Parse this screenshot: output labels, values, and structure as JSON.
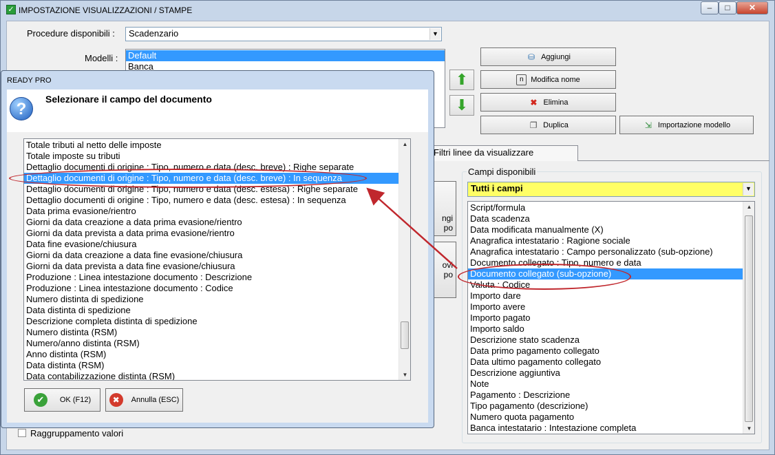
{
  "main": {
    "title": "IMPOSTAZIONE VISUALIZZAZIONI / STAMPE",
    "caption_buttons": {
      "minimize": "–",
      "maximize": "□",
      "close": "✕"
    },
    "procedure_label": "Procedure disponibili :",
    "procedure_value": "Scadenzario",
    "models_label": "Modelli :",
    "models": [
      "Default",
      "Banca"
    ],
    "buttons": {
      "add": "Aggiungi",
      "rename": "Modifica nome",
      "delete": "Elimina",
      "duplicate": "Duplica",
      "import": "Importazione modello"
    },
    "tab_filters": "Filtri linee da visualizzare",
    "partial_button_1": [
      "ngi",
      "po"
    ],
    "partial_button_2": [
      "ovi",
      "po"
    ],
    "available_fields_legend": "Campi disponibili",
    "fields_filter": "Tutti i campi",
    "fields": [
      "Script/formula",
      "Data scadenza",
      "Data modificata manualmente (X)",
      "Anagrafica intestatario : Ragione sociale",
      "Anagrafica intestatario : Campo personalizzato (sub-opzione)",
      "Documento collegato : Tipo, numero e data",
      "Documento collegato (sub-opzione)",
      "Valuta : Codice",
      "Importo dare",
      "Importo avere",
      "Importo pagato",
      "Importo saldo",
      "Descrizione stato scadenza",
      "Data primo pagamento collegato",
      "Data ultimo pagamento collegato",
      "Descrizione aggiuntiva",
      "Note",
      "Pagamento : Descrizione",
      "Tipo pagamento (descrizione)",
      "Numero quota pagamento",
      "Banca intestatario : Intestazione completa"
    ],
    "fields_selected_index": 6,
    "grouping_label": "Raggruppamento valori",
    "colors": {
      "selection": "#3399ff",
      "filter_bg": "#ffff66",
      "annotation": "#c0272d"
    }
  },
  "dialog": {
    "title": "READY PRO",
    "heading": "Selezionare il campo del documento",
    "items": [
      "Totale tributi al netto delle imposte",
      "Totale imposte su tributi",
      "Dettaglio documenti di origine : Tipo, numero e data (desc. breve) : Righe separate",
      "Dettaglio documenti di origine : Tipo, numero e data (desc. breve) : In sequenza",
      "Dettaglio documenti di origine : Tipo, numero e data (desc. estesa) : Righe separate",
      "Dettaglio documenti di origine : Tipo, numero e data (desc. estesa) : In sequenza",
      "Data prima evasione/rientro",
      "Giorni da data creazione a data prima evasione/rientro",
      "Giorni da data prevista a data prima evasione/rientro",
      "Data fine evasione/chiusura",
      "Giorni da data creazione a data fine evasione/chiusura",
      "Giorni da data prevista a data fine evasione/chiusura",
      "Produzione : Linea intestazione documento : Descrizione",
      "Produzione : Linea intestazione documento : Codice",
      "Numero distinta di spedizione",
      "Data distinta di spedizione",
      "Descrizione completa distinta di spedizione",
      "Numero distinta (RSM)",
      "Numero/anno distinta (RSM)",
      "Anno distinta (RSM)",
      "Data distinta (RSM)",
      "Data contabilizzazione distinta (RSM)"
    ],
    "selected_index": 3,
    "ok_label": "OK (F12)",
    "cancel_label": "Annulla (ESC)"
  }
}
